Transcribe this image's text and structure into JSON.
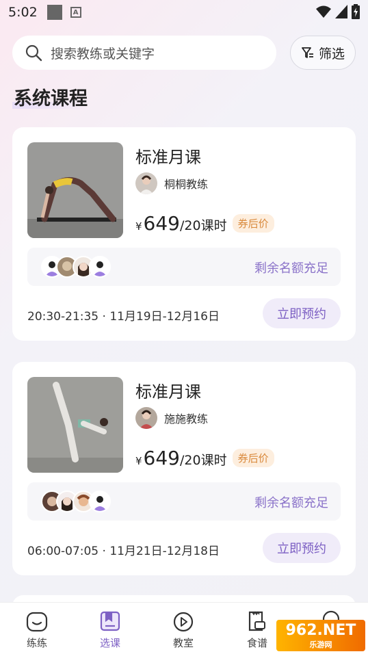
{
  "status": {
    "time": "5:02"
  },
  "search": {
    "placeholder": "搜索教练或关键字"
  },
  "filter": {
    "label": "筛选"
  },
  "section": {
    "title": "系统课程"
  },
  "courses": [
    {
      "title": "标准月课",
      "coach": "桐桐教练",
      "yen": "¥",
      "price": "649",
      "unit": "/20课时",
      "coupon": "券后价",
      "slots": "剩余名额充足",
      "time": "20:30-21:35 · 11月19日-12月16日",
      "book": "立即预约"
    },
    {
      "title": "标准月课",
      "coach": "施施教练",
      "yen": "¥",
      "price": "649",
      "unit": "/20课时",
      "coupon": "券后价",
      "slots": "剩余名额充足",
      "time": "06:00-07:05 · 11月21日-12月18日",
      "book": "立即预约"
    }
  ],
  "tabs": [
    {
      "label": "练练",
      "icon": "smile-face-icon"
    },
    {
      "label": "选课",
      "icon": "book-icon"
    },
    {
      "label": "教室",
      "icon": "play-icon"
    },
    {
      "label": "食谱",
      "icon": "recipe-icon"
    },
    {
      "label": "",
      "icon": "profile-icon"
    }
  ],
  "watermark": {
    "big": "962.NET",
    "small": "乐游网"
  },
  "colors": {
    "accent": "#7d60c4",
    "coupon_bg": "#fdeede",
    "coupon_text": "#d9893b"
  }
}
